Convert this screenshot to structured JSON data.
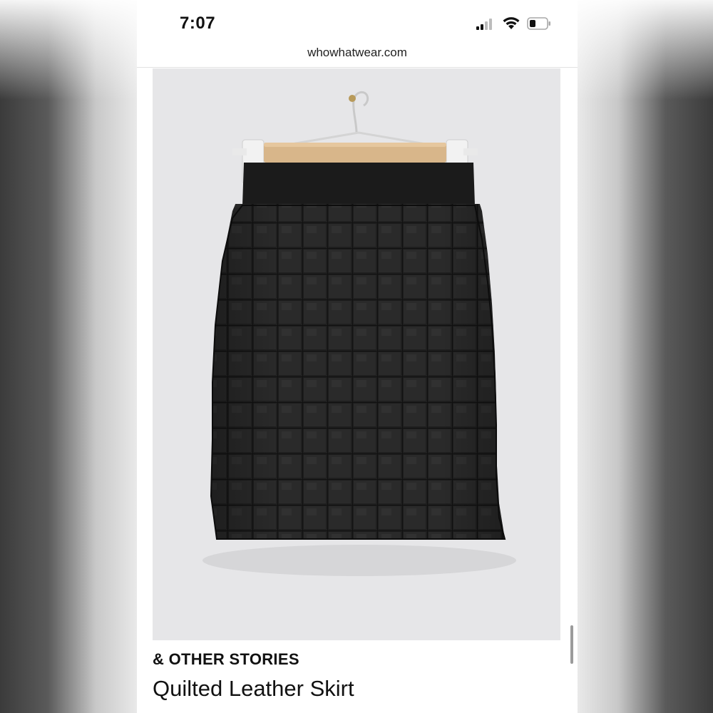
{
  "status_bar": {
    "time": "7:07",
    "icons": [
      "signal-icon",
      "wifi-icon",
      "battery-icon"
    ]
  },
  "browser": {
    "url": "whowhatwear.com"
  },
  "product": {
    "image_subject": "quilted-leather-skirt-image",
    "brand": "& OTHER STORIES",
    "name": "Quilted Leather Skirt"
  },
  "colors": {
    "background": "#ffffff",
    "image_backdrop": "#e6e6e8",
    "skirt": "#1e1e1e",
    "hanger_wood": "#d8b68a",
    "text": "#111111"
  }
}
